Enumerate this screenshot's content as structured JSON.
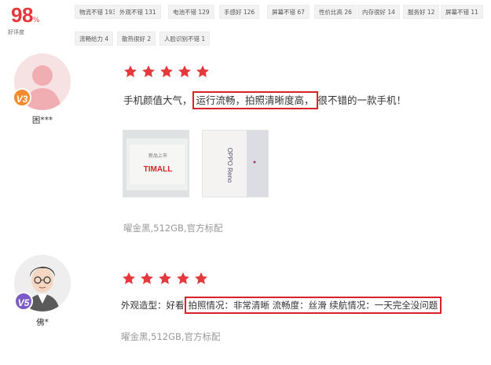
{
  "rating": {
    "value": "98",
    "percent_sign": "%",
    "label": "好评度"
  },
  "tags": [
    "物流不错 193",
    "外观不错 131",
    "电池不错 129",
    "手感好 126",
    "屏幕不错 67",
    "性价比高 26",
    "内存很好 14",
    "服务好 12",
    "屏幕不错 11",
    "流畅给力 4",
    "散热很好 2",
    "人脸识别不错 1"
  ],
  "reviews": [
    {
      "user": "困***",
      "level": "V3",
      "stars": 5,
      "text_before": "手机颜值大气，",
      "text_highlight": "运行流畅，拍照清晰度高，",
      "text_after": "很不错的一款手机！",
      "photo1_text": "TIMALL",
      "photo1_sub": "新品上市",
      "photo2_text": "OPPO Reno",
      "spec": "曜金黑,512GB,官方标配"
    },
    {
      "user": "佛*",
      "level": "V5",
      "stars": 5,
      "text_before": "外观造型：好看",
      "text_highlight": "拍照情况：非常清晰 流畅度：丝滑 续航情况：一天完全没问题",
      "text_after": "",
      "spec": "曜金黑,512GB,官方标配"
    }
  ],
  "colors": {
    "accent": "#e4393c",
    "highlight_border": "#d8232a",
    "star": "#e4393c"
  },
  "icons": {
    "star": "star-icon",
    "avatar1": "default-user-icon",
    "avatar2": "cartoon-man-avatar"
  }
}
